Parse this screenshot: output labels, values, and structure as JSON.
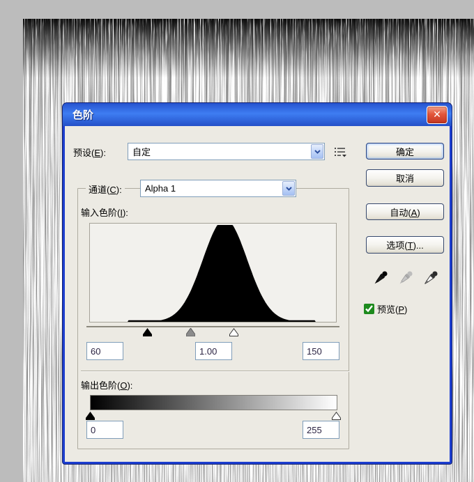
{
  "workspace": {
    "bg_color": "#bcbcbc",
    "canvas_texture": "white-vertical-fiber-streaks"
  },
  "dialog": {
    "title": "色阶",
    "titlebar_color": "#2e5fd8",
    "border_color": "#1c3ed0",
    "close_icon": "✕"
  },
  "preset": {
    "label": {
      "pre": "预设(",
      "key": "E",
      "post": "):"
    },
    "value": "自定"
  },
  "channel": {
    "label": {
      "pre": "通道(",
      "key": "C",
      "post": "):"
    },
    "value": "Alpha 1"
  },
  "input_levels": {
    "label": {
      "pre": "输入色阶(",
      "key": "I",
      "post": "):"
    },
    "black": "60",
    "gamma": "1.00",
    "white": "150"
  },
  "output_levels": {
    "label": {
      "pre": "输出色阶(",
      "key": "O",
      "post": "):"
    },
    "black": "0",
    "white": "255"
  },
  "buttons": {
    "ok": "确定",
    "cancel": "取消",
    "auto": {
      "pre": "自动(",
      "key": "A",
      "post": ")"
    },
    "options": {
      "pre": "选项(",
      "key": "T",
      "post": ")..."
    }
  },
  "icons": {
    "flyout": "preset-options-icon",
    "eyedroppers": [
      "black-point-eyedropper",
      "gray-point-eyedropper",
      "white-point-eyedropper"
    ]
  },
  "preview": {
    "label": {
      "pre": "预览(",
      "key": "P",
      "post": ")"
    },
    "checked": true
  },
  "histogram": {
    "type": "histogram",
    "range": [
      0,
      255
    ],
    "peak_value": 140,
    "sigma": 23,
    "peak_scale": 1.06,
    "baseline_range": [
      40,
      233
    ],
    "color": "#000000"
  }
}
